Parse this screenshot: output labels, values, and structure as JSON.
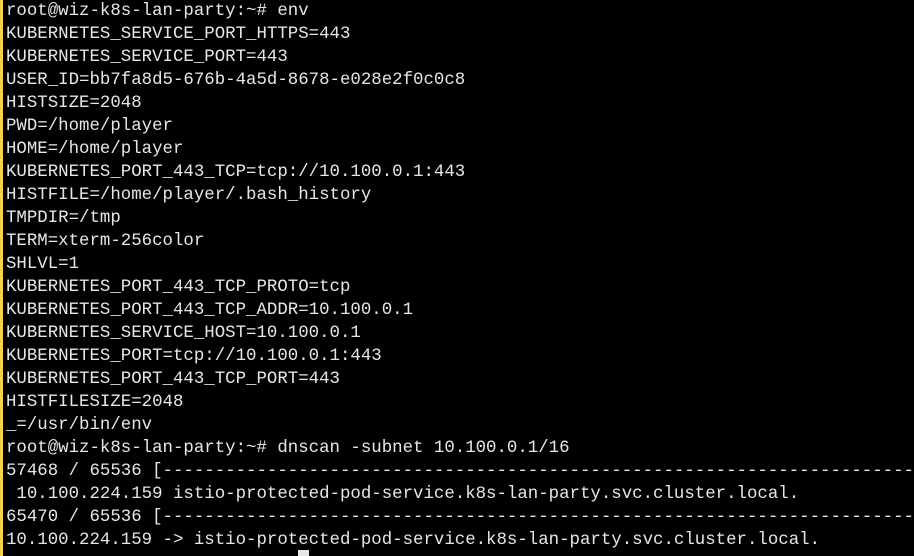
{
  "terminal": {
    "lines": [
      "root@wiz-k8s-lan-party:~# env",
      "KUBERNETES_SERVICE_PORT_HTTPS=443",
      "KUBERNETES_SERVICE_PORT=443",
      "USER_ID=bb7fa8d5-676b-4a5d-8678-e028e2f0c0c8",
      "HISTSIZE=2048",
      "PWD=/home/player",
      "HOME=/home/player",
      "KUBERNETES_PORT_443_TCP=tcp://10.100.0.1:443",
      "HISTFILE=/home/player/.bash_history",
      "TMPDIR=/tmp",
      "TERM=xterm-256color",
      "SHLVL=1",
      "KUBERNETES_PORT_443_TCP_PROTO=tcp",
      "KUBERNETES_PORT_443_TCP_ADDR=10.100.0.1",
      "KUBERNETES_SERVICE_HOST=10.100.0.1",
      "KUBERNETES_PORT=tcp://10.100.0.1:443",
      "KUBERNETES_PORT_443_TCP_PORT=443",
      "HISTFILESIZE=2048",
      "_=/usr/bin/env",
      "root@wiz-k8s-lan-party:~# dnscan -subnet 10.100.0.1/16",
      "57468 / 65536 [-----------------------------------------------------------------------------",
      " 10.100.224.159 istio-protected-pod-service.k8s-lan-party.svc.cluster.local.",
      "65470 / 65536 [-----------------------------------------------------------------------------",
      "10.100.224.159 -> istio-protected-pod-service.k8s-lan-party.svc.cluster.local."
    ]
  }
}
